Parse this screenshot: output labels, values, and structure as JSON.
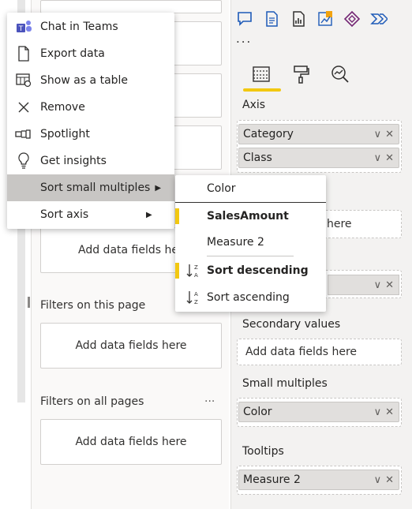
{
  "menu": {
    "items": [
      {
        "label": "Chat in Teams",
        "icon": "teams-icon"
      },
      {
        "label": "Export data",
        "icon": "export-icon"
      },
      {
        "label": "Show as a table",
        "icon": "table-view-icon"
      },
      {
        "label": "Remove",
        "icon": "close-icon"
      },
      {
        "label": "Spotlight",
        "icon": "spotlight-icon"
      },
      {
        "label": "Get insights",
        "icon": "lightbulb-icon"
      },
      {
        "label": "Sort small multiples",
        "icon": "chevron-right-icon",
        "highlighted": true
      },
      {
        "label": "Sort axis",
        "icon": "chevron-right-icon"
      }
    ]
  },
  "submenu": {
    "items": [
      {
        "label": "Color",
        "selected": false
      },
      {
        "label": "SalesAmount",
        "selected": true
      },
      {
        "label": "Measure 2",
        "selected": false
      },
      {
        "label": "Sort descending",
        "selected": true
      },
      {
        "label": "Sort ascending",
        "selected": false
      }
    ]
  },
  "filters": {
    "add_text_1": "Add data fields here",
    "page_title": "Filters on this page",
    "add_text_2": "Add data fields here",
    "all_title": "Filters on all pages",
    "all_more": "...",
    "add_text_3": "Add data fields here"
  },
  "viz": {
    "more": "...",
    "wells": {
      "axis_label": "Axis",
      "axis_chips": [
        "Category",
        "Class"
      ],
      "values_add": "here",
      "secondary_label": "Secondary values",
      "secondary_add": "Add data fields here",
      "small_multiples_label": "Small multiples",
      "small_multiples_chip": "Color",
      "tooltips_label": "Tooltips",
      "tooltips_chip": "Measure 2"
    }
  },
  "colors": {
    "accent": "#f2c811",
    "highlight": "#c8c6c4",
    "icon_blue": "#1d5ab8"
  }
}
